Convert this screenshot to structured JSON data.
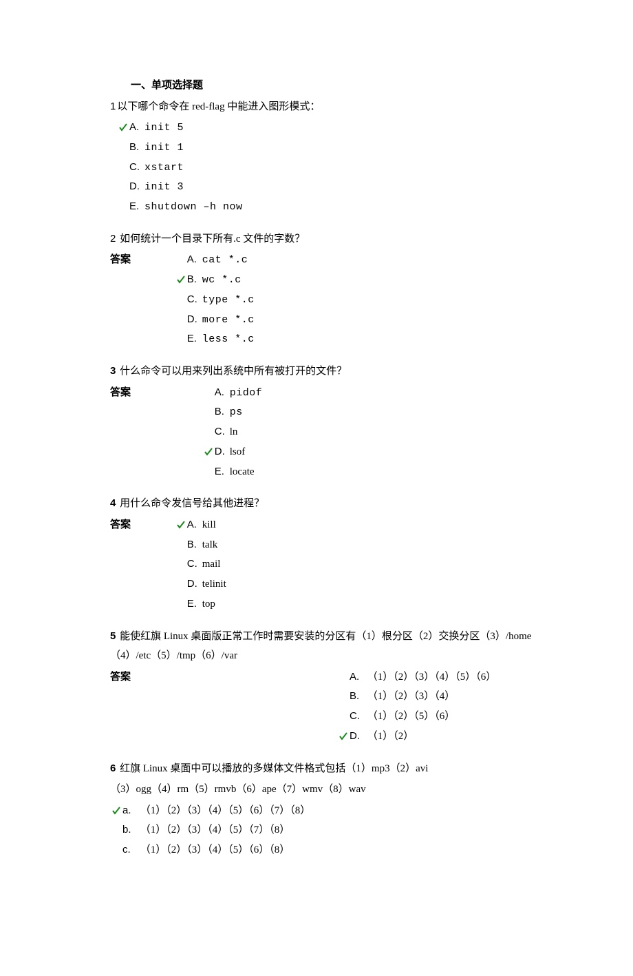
{
  "section_title": "一、单项选择题",
  "questions": {
    "q1": {
      "num": "1",
      "text": "以下哪个命令在 red-flag 中能进入图形模式：",
      "options": {
        "A": "init 5",
        "B": "init 1",
        "C": "xstart",
        "D": "init 3",
        "E": "shutdown  –h now"
      },
      "answer": "A"
    },
    "q2": {
      "num": "2",
      "text": "如何统计一个目录下所有.c 文件的字数？",
      "answer_label": "答案",
      "options": {
        "A": "cat *.c",
        "B": "wc *.c",
        "C": "type *.c",
        "D": "more *.c",
        "E": "less *.c"
      },
      "answer": "B"
    },
    "q3": {
      "num": "3",
      "text": "什么命令可以用来列出系统中所有被打开的文件？",
      "answer_label": "答案",
      "options": {
        "A": "pidof",
        "B": "ps",
        "C": "ln",
        "D": "lsof",
        "E": "locate"
      },
      "answer": "D"
    },
    "q4": {
      "num": "4",
      "text": "用什么命令发信号给其他进程？",
      "answer_label": "答案",
      "options": {
        "A": "kill",
        "B": "talk",
        "C": "mail",
        "D": "telinit",
        "E": "top"
      },
      "answer": "A"
    },
    "q5": {
      "num": "5",
      "text": "能使红旗 Linux 桌面版正常工作时需要安装的分区有（1）根分区（2）交换分区（3）/home（4）/etc（5）/tmp（6）/var",
      "answer_label": "答案",
      "options": {
        "A": "（1）（2）（3）（4）（5）（6）",
        "B": "（1）（2）（3）（4）",
        "C": "（1）（2）（5）（6）",
        "D": "（1）（2）"
      },
      "answer": "D"
    },
    "q6": {
      "num": "6",
      "text": "红旗 Linux 桌面中可以播放的多媒体文件格式包括（1）mp3（2）avi",
      "text2": "（3）ogg（4）rm（5）rmvb（6）ape（7）wmv（8）wav",
      "options": {
        "a": "（1）（2）（3）（4）（5）（6）（7）（8）",
        "b": "（1）（2）（3）（4）（5）（7）（8）",
        "c": "（1）（2）（3）（4）（5）（6）（8）"
      },
      "answer": "a"
    }
  }
}
